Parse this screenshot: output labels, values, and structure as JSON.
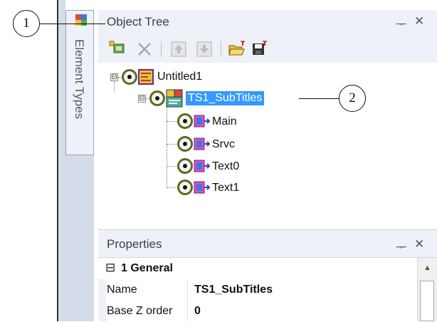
{
  "callouts": {
    "one": "1",
    "two": "2"
  },
  "side_tab": {
    "label": "Element Types"
  },
  "object_tree": {
    "title": "Object Tree",
    "pin_icon": "pin-icon",
    "close_icon": "close-icon",
    "pin_glyph": "ᅮ",
    "close_glyph": "✕",
    "toolbar": [
      "add-element-icon",
      "delete-icon",
      "move-up-icon",
      "move-down-icon",
      "open-template-icon",
      "save-template-icon"
    ],
    "nodes": [
      {
        "label": "Untitled1",
        "expander": "⊟"
      },
      {
        "label": "TS1_SubTitles",
        "expander": "⊟",
        "selected": true
      },
      {
        "label": "Main"
      },
      {
        "label": "Srvc"
      },
      {
        "label": "Text0"
      },
      {
        "label": "Text1"
      }
    ]
  },
  "properties": {
    "title": "Properties",
    "pin_glyph": "ᅮ",
    "close_glyph": "✕",
    "category": {
      "expander": "⊟",
      "label": "1 General"
    },
    "rows": [
      {
        "name": "Name",
        "value": "TS1_SubTitles"
      },
      {
        "name": "Base Z order",
        "value": "0"
      }
    ],
    "scroll_up_glyph": "▲"
  },
  "colors": {
    "selection": "#3399ff",
    "panel_header": "#eef1f7",
    "eye_ring": "#5a6b20"
  }
}
